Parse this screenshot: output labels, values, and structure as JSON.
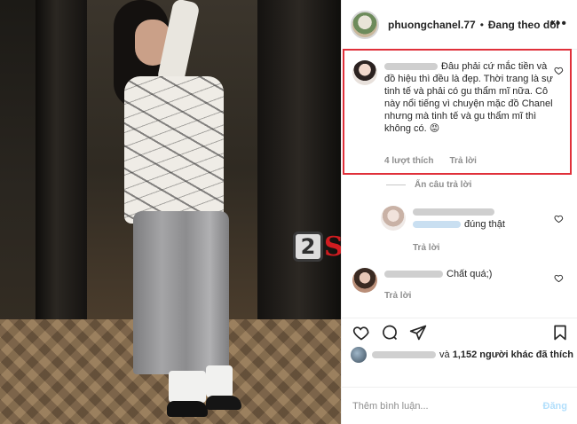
{
  "post": {
    "username": "phuongchanel.77",
    "separator": "•",
    "follow_status": "Đang theo dõi",
    "more_icon": "more-dots-icon"
  },
  "comments": [
    {
      "text": "Đâu phải cứ mắc tiền và đồ hiệu thì đều là đẹp. Thời trang là sự tinh tế và phải có gu thẩm mĩ nữa. Cô này nổi tiếng vì chuyện mặc đồ Chanel nhưng mà tinh tế và gu thẩm mĩ thì không có. 😡",
      "likes": "4 lượt thích",
      "reply": "Trả lời"
    },
    {
      "text": "đúng thật",
      "reply": "Trả lời"
    },
    {
      "text": "Chất quá;)",
      "reply": "Trả lời"
    }
  ],
  "hide_replies": "Ẩn câu trả lời",
  "likes_summary": {
    "prefix": "và",
    "count": "1,152",
    "suffix": "người khác đã thích"
  },
  "comment_box": {
    "placeholder": "Thêm bình luận...",
    "post_label": "Đăng"
  },
  "watermark": {
    "box": "2",
    "word": "Sao"
  },
  "colors": {
    "highlight": "#e0303a",
    "watermark_red": "#d01c20",
    "muted": "#8e8e8e",
    "post_disabled": "#b2dffc"
  }
}
